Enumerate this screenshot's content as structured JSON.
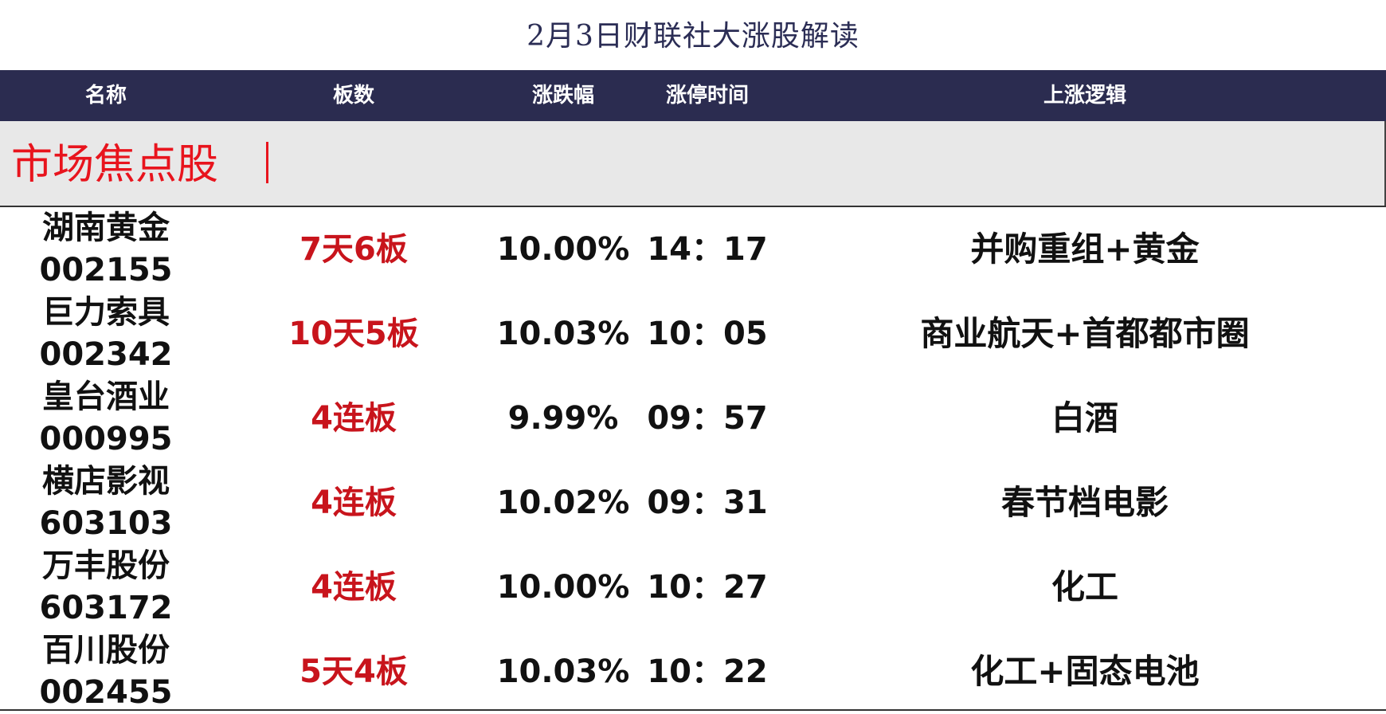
{
  "title": "2月3日财联社大涨股解读",
  "columns": [
    "名称",
    "板数",
    "涨跌幅",
    "涨停时间",
    "上涨逻辑"
  ],
  "section": {
    "label": "市场焦点股",
    "color": "#e8141d"
  },
  "colors": {
    "header_bg": "#2b2c50",
    "board_text": "#c8141c",
    "section_bg": "#e8e8e8"
  },
  "rows": [
    {
      "name": "湖南黄金",
      "code": "002155",
      "board": "7天6板",
      "change": "10.00%",
      "time": "14：17",
      "logic": "并购重组+黄金"
    },
    {
      "name": "巨力索具",
      "code": "002342",
      "board": "10天5板",
      "change": "10.03%",
      "time": "10：05",
      "logic": "商业航天+首都都市圈"
    },
    {
      "name": "皇台酒业",
      "code": "000995",
      "board": "4连板",
      "change": "9.99%",
      "time": "09：57",
      "logic": "白酒"
    },
    {
      "name": "横店影视",
      "code": "603103",
      "board": "4连板",
      "change": "10.02%",
      "time": "09：31",
      "logic": "春节档电影"
    },
    {
      "name": "万丰股份",
      "code": "603172",
      "board": "4连板",
      "change": "10.00%",
      "time": "10：27",
      "logic": "化工"
    },
    {
      "name": "百川股份",
      "code": "002455",
      "board": "5天4板",
      "change": "10.03%",
      "time": "10：22",
      "logic": "化工+固态电池"
    }
  ]
}
